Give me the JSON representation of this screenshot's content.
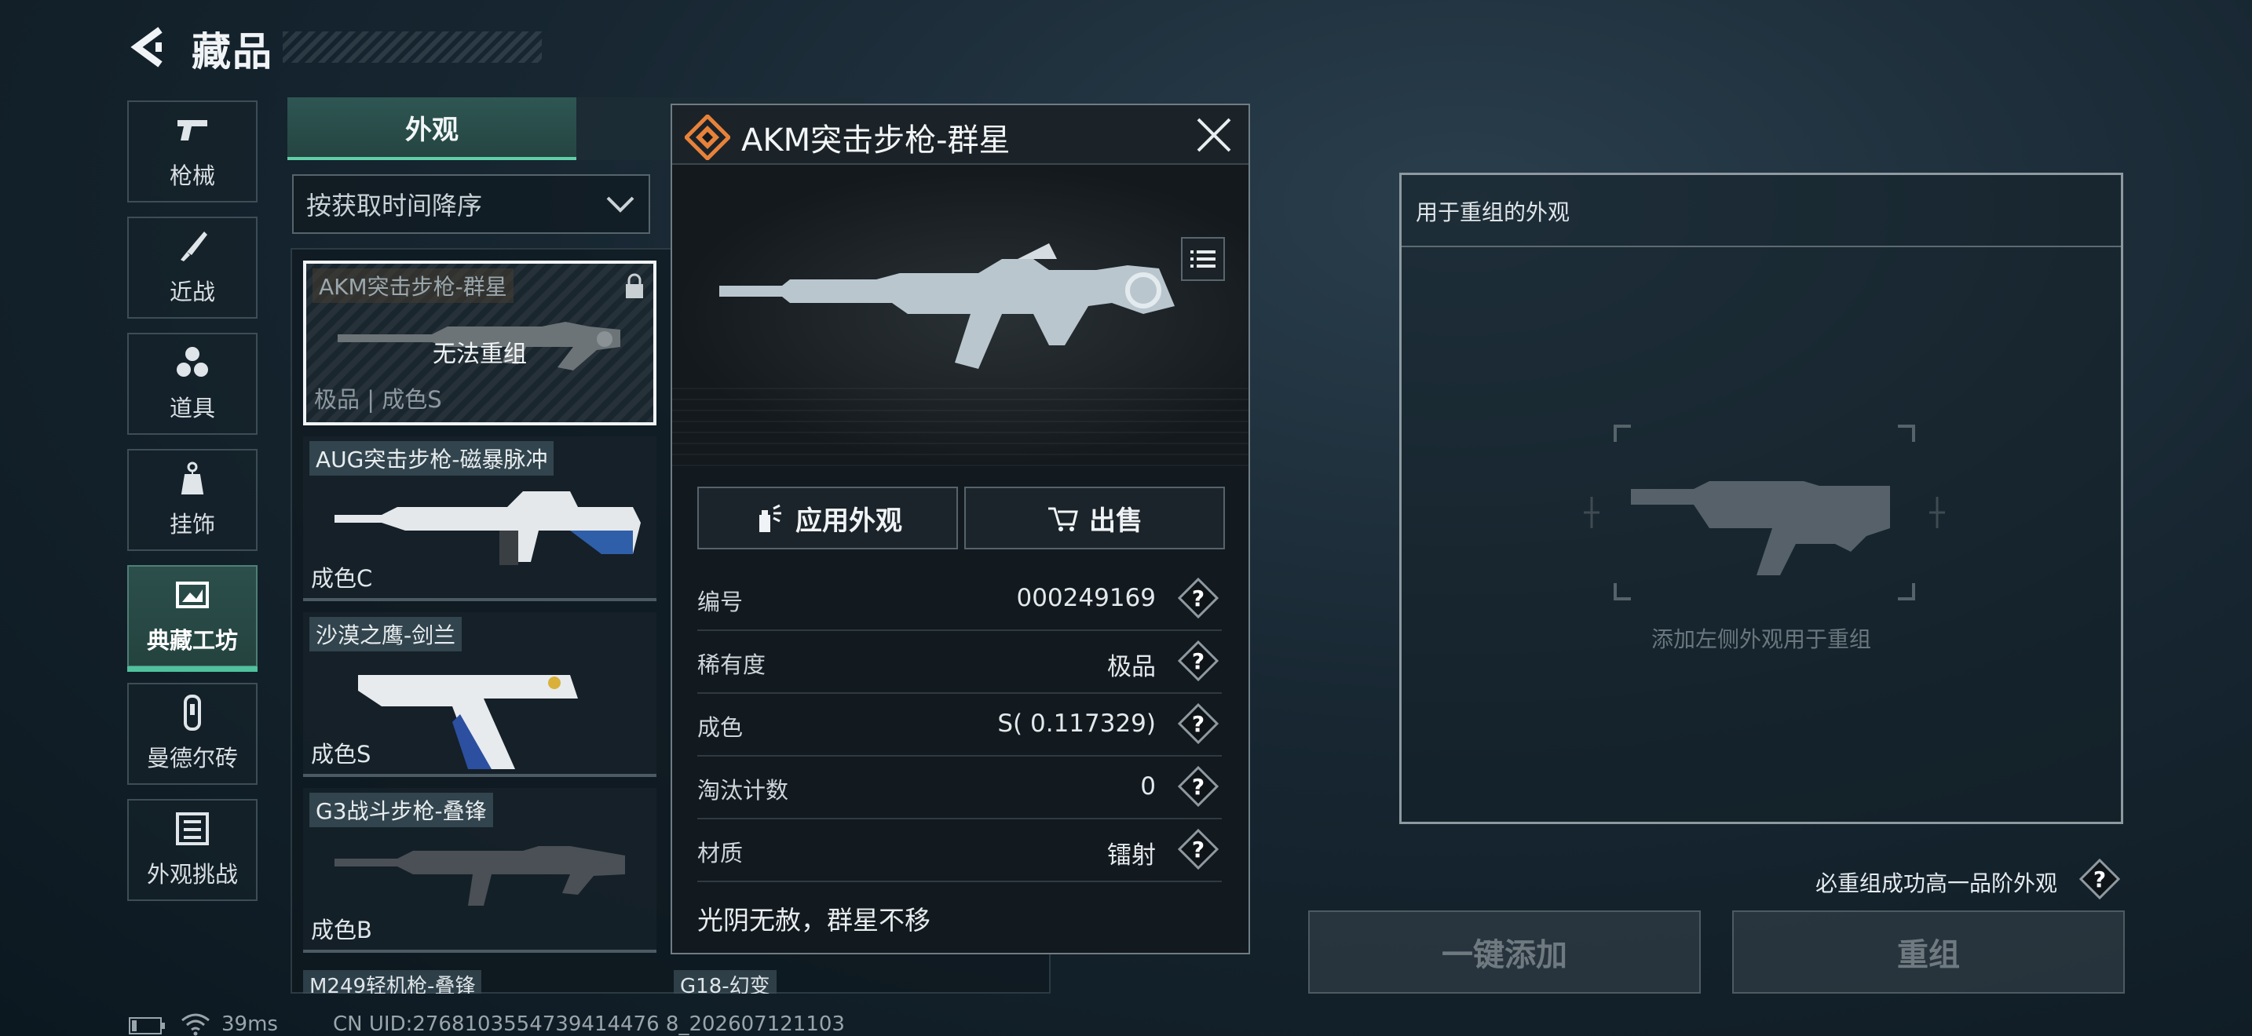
{
  "header": {
    "title": "藏品"
  },
  "categories": [
    {
      "label": "枪械",
      "icon": "pistol-icon",
      "active": false
    },
    {
      "label": "近战",
      "icon": "knife-icon",
      "active": false
    },
    {
      "label": "道具",
      "icon": "grenades-icon",
      "active": false
    },
    {
      "label": "挂饰",
      "icon": "charm-icon",
      "active": false
    },
    {
      "label": "典藏工坊",
      "icon": "workshop-icon",
      "active": true
    },
    {
      "label": "曼德尔砖",
      "icon": "brick-icon",
      "active": false
    },
    {
      "label": "外观挑战",
      "icon": "challenge-icon",
      "active": false
    }
  ],
  "tabs": {
    "appearance": "外观"
  },
  "sort": {
    "value": "按获取时间降序"
  },
  "items": [
    {
      "name": "AKM突击步枪-群星",
      "grade": "极品 | 成色S",
      "overlay": "无法重组",
      "locked": true,
      "selected": true
    },
    {
      "name": "AUG突击步枪-磁暴脉冲",
      "grade": "成色C"
    },
    {
      "name": "沙漠之鹰-剑兰",
      "grade": "成色S"
    },
    {
      "name": "G3战斗步枪-叠锋",
      "grade": "成色B"
    },
    {
      "name": "M249轻机枪-叠锋"
    },
    {
      "name": "G18-幻变"
    }
  ],
  "detail": {
    "title": "AKM突击步枪-群星",
    "apply_label": "应用外观",
    "sell_label": "出售",
    "properties": [
      {
        "key": "编号",
        "value": "000249169"
      },
      {
        "key": "稀有度",
        "value": "极品"
      },
      {
        "key": "成色",
        "value": "S( 0.117329)"
      },
      {
        "key": "淘汰计数",
        "value": "0"
      },
      {
        "key": "材质",
        "value": "镭射"
      }
    ],
    "description": "光阴无赦，群星不移"
  },
  "recombine": {
    "title": "用于重组的外观",
    "hint": "添加左侧外观用于重组",
    "guarantee": "必重组成功高一品阶外观",
    "add_all_label": "一键添加",
    "recombine_label": "重组"
  },
  "footer": {
    "ping": "39ms",
    "uid": "CN UID:2768103554739414476 8_202607121103"
  },
  "colors": {
    "accent": "#4fc19c",
    "rarity": "#e8823a"
  }
}
